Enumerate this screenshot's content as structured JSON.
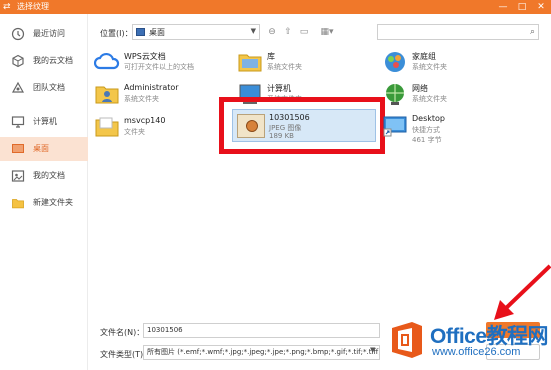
{
  "window": {
    "title": "选择纹理",
    "app_icon": "wps-icon"
  },
  "sidebar": {
    "items": [
      {
        "label": "最近访问",
        "icon": "clock-icon"
      },
      {
        "label": "我的云文档",
        "icon": "cloud-doc-icon"
      },
      {
        "label": "团队文档",
        "icon": "team-icon"
      },
      {
        "label": "计算机",
        "icon": "computer-icon"
      },
      {
        "label": "桌面",
        "icon": "desktop-icon",
        "active": true
      },
      {
        "label": "我的文档",
        "icon": "documents-icon"
      },
      {
        "label": "新建文件夹",
        "icon": "folder-icon"
      }
    ]
  },
  "toolbar": {
    "location_label": "位置(I)：",
    "location_value": "桌面",
    "search_placeholder": ""
  },
  "files": [
    {
      "name": "WPS云文档",
      "sub": "可打开文件以上的文档",
      "icon": "cloud-icon"
    },
    {
      "name": "库",
      "sub": "系统文件夹",
      "icon": "library-icon"
    },
    {
      "name": "家庭组",
      "sub": "系统文件夹",
      "icon": "homegroup-icon"
    },
    {
      "name": "Administrator",
      "sub": "系统文件夹",
      "icon": "user-folder-icon"
    },
    {
      "name": "计算机",
      "sub": "系统文件夹",
      "icon": "computer-icon"
    },
    {
      "name": "网络",
      "sub": "系统文件夹",
      "icon": "network-icon"
    },
    {
      "name": "msvcp140",
      "sub": "文件夹",
      "icon": "folder-icon"
    },
    {
      "name": "10301506",
      "sub": "JPEG 图像",
      "sub2": "189 KB",
      "icon": "image-icon",
      "selected": true
    },
    {
      "name": "Desktop",
      "sub": "快捷方式",
      "sub2": "461 字节",
      "icon": "shortcut-icon"
    }
  ],
  "bottom": {
    "filename_label": "文件名(N)：",
    "filename_value": "10301506",
    "filetype_label": "文件类型(T)：",
    "filetype_value": "所有图片 (*.emf;*.wmf;*.jpg;*.jpeg;*.jpe;*.png;*.bmp;*.gif;*.tif;*.tiff)"
  },
  "colors": {
    "accent": "#f0782a",
    "highlight": "#e8101a",
    "selection": "#d7e8f7"
  },
  "watermark": {
    "brand": "Office教程网",
    "site": "www.office26.com"
  }
}
